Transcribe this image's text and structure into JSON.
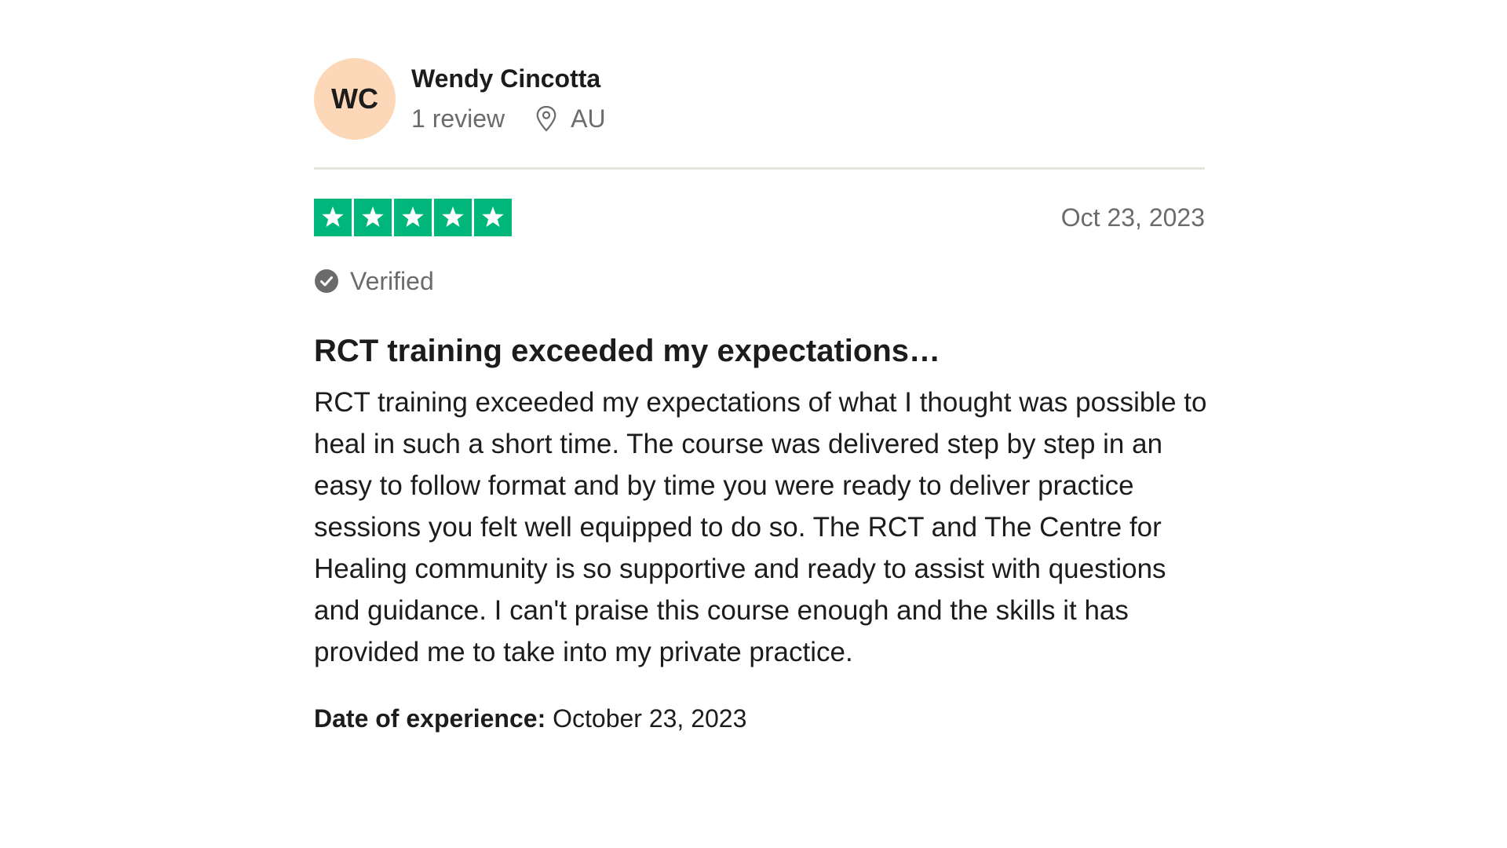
{
  "consumer": {
    "initials": "WC",
    "name": "Wendy Cincotta",
    "review_count": "1 review",
    "location": "AU",
    "location_icon": "location-pin-icon"
  },
  "review": {
    "rating": 5,
    "rating_max": 5,
    "star_icon": "star-icon",
    "date": "Oct 23, 2023",
    "verified_label": "Verified",
    "verified_icon": "checkmark-circle-icon",
    "title": "RCT training exceeded my expectations…",
    "body": "RCT training exceeded my expectations of what I thought was possible to heal in such a short time. The course was delivered step by step in an easy to follow format and by time you were ready to deliver practice sessions you felt well equipped to do so. The RCT and The Centre for Healing community is so supportive and ready to assist with questions and guidance. I can't praise this course enough and the skills it has provided me to take into my private practice.",
    "experience_label": "Date of experience:",
    "experience_date": "October 23, 2023"
  },
  "colors": {
    "avatar_bg": "#fdd8b8",
    "star_green": "#00b67a",
    "muted_text": "#6b6b6b",
    "divider": "#e5e5dd"
  }
}
